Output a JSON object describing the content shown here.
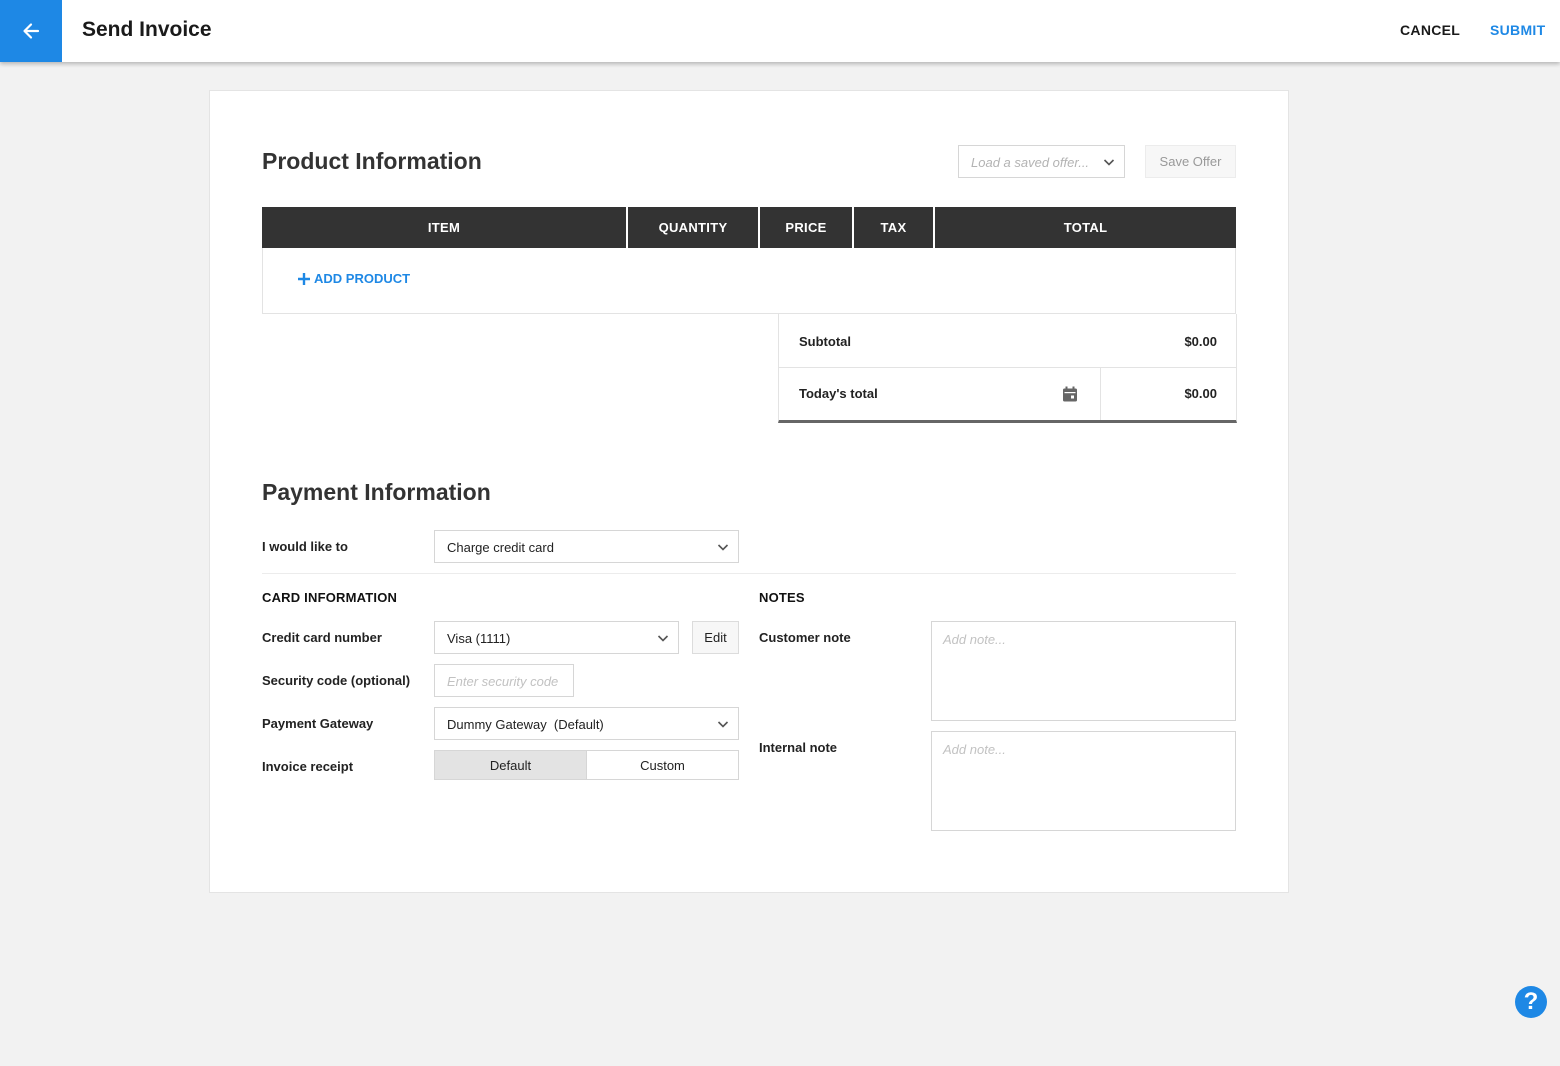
{
  "header": {
    "back_icon": "arrow-left-icon",
    "title": "Send Invoice",
    "cancel_label": "CANCEL",
    "submit_label": "SUBMIT",
    "accent_color": "#1e88e5"
  },
  "product_info": {
    "title": "Product Information",
    "saved_offer_placeholder": "Load a saved offer...",
    "save_offer_label": "Save Offer",
    "columns": [
      "ITEM",
      "QUANTITY",
      "PRICE",
      "TAX",
      "TOTAL"
    ],
    "add_product_label": "ADD PRODUCT",
    "subtotal_label": "Subtotal",
    "subtotal_value": "$0.00",
    "todays_total_label": "Today's total",
    "todays_total_value": "$0.00",
    "calendar_icon": "calendar-icon"
  },
  "payment_info": {
    "title": "Payment Information",
    "action_label": "I would like to",
    "action_value": "Charge credit card",
    "card_section": {
      "heading": "CARD INFORMATION",
      "card_number_label": "Credit card number",
      "card_number_value": "Visa (1111)",
      "edit_label": "Edit",
      "security_label": "Security code (optional)",
      "security_placeholder": "Enter security code",
      "gateway_label": "Payment Gateway",
      "gateway_value": "Dummy Gateway  (Default)",
      "receipt_label": "Invoice receipt",
      "receipt_options": [
        "Default",
        "Custom"
      ],
      "receipt_selected": "Default"
    },
    "notes_section": {
      "heading": "NOTES",
      "customer_note_label": "Customer note",
      "customer_note_placeholder": "Add note...",
      "internal_note_label": "Internal note",
      "internal_note_placeholder": "Add note..."
    }
  },
  "help_icon": "question-icon",
  "help_glyph": "?"
}
